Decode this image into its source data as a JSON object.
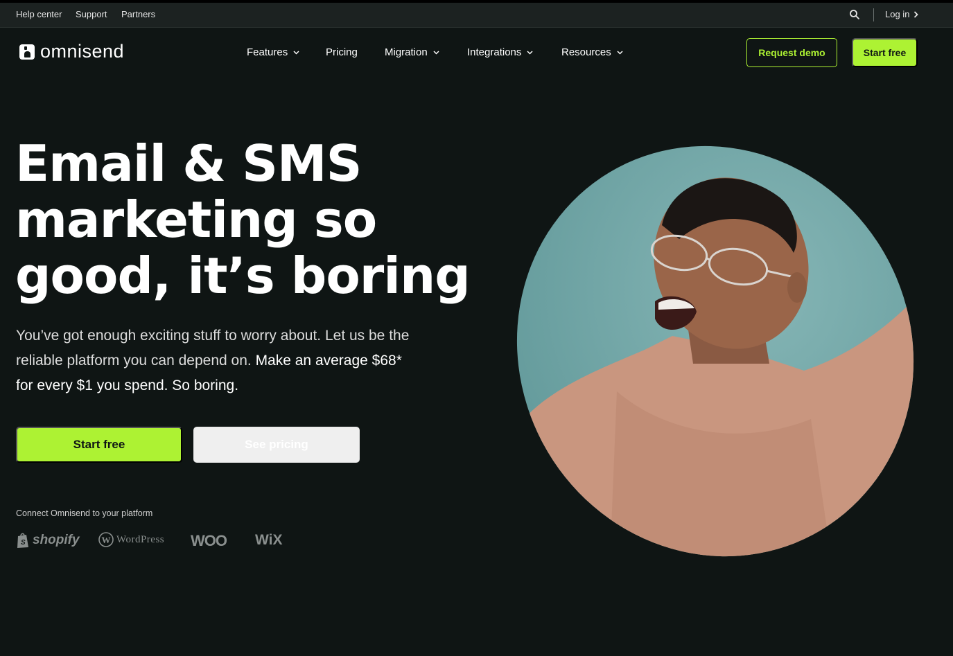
{
  "utility_bar": {
    "links": [
      "Help center",
      "Support",
      "Partners"
    ],
    "login_label": "Log in"
  },
  "brand": {
    "name": "omnisend"
  },
  "nav": {
    "items": [
      {
        "label": "Features",
        "has_dropdown": true
      },
      {
        "label": "Pricing",
        "has_dropdown": false
      },
      {
        "label": "Migration",
        "has_dropdown": true
      },
      {
        "label": "Integrations",
        "has_dropdown": true
      },
      {
        "label": "Resources",
        "has_dropdown": true
      }
    ],
    "request_demo_label": "Request demo",
    "start_free_label": "Start free"
  },
  "hero": {
    "title_lines": [
      "Email & SMS",
      "marketing so",
      "good, it’s boring"
    ],
    "subtitle_plain": "You’ve got enough exciting stuff to worry about. Let us be the reliable platform you can depend on. ",
    "subtitle_bold": "Make an average $68* for every $1 you spend. So boring.",
    "cta_primary": "Start free",
    "cta_secondary": "See pricing",
    "connect_label": "Connect Omnisend to your platform",
    "platforms": [
      "shopify",
      "WordPress",
      "WOO",
      "WiX"
    ]
  },
  "colors": {
    "background": "#0f1514",
    "accent": "#adf233",
    "utility_bar": "#1c2221",
    "photo_backdrop": "#6ea3a4",
    "sweater": "#c9967f"
  },
  "icons": {
    "search": "search-icon",
    "login_arrow": "chevron-right-icon",
    "dropdown": "chevron-down-icon",
    "logo": "omnisend-logo-icon"
  }
}
